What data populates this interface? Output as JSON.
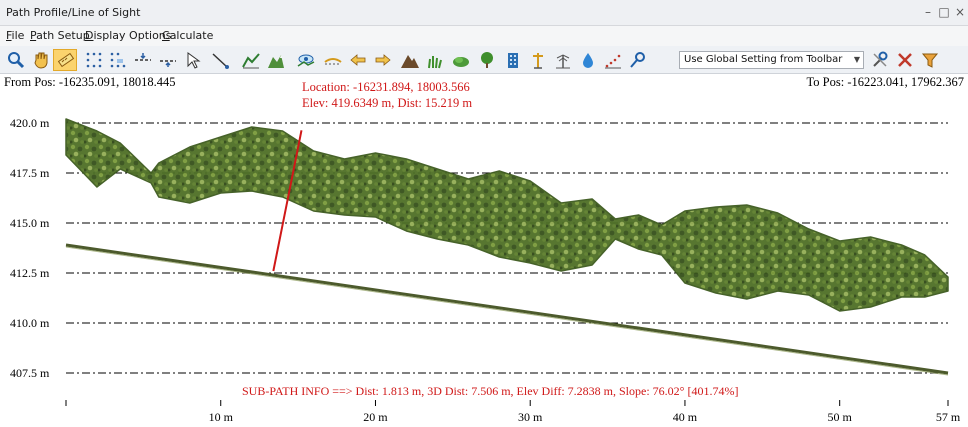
{
  "window": {
    "title": "Path Profile/Line of Sight",
    "minimize_glyph": "–",
    "maximize_glyph": "□",
    "close_glyph": "×"
  },
  "menu": [
    {
      "label": "File",
      "underline": "F",
      "rest": "ile"
    },
    {
      "label": "Path Setup",
      "underline": "P",
      "rest": "ath Setup"
    },
    {
      "label": "Display Options",
      "underline": "D",
      "rest": "isplay Options"
    },
    {
      "label": "Calculate",
      "underline": "C",
      "rest": "alculate"
    }
  ],
  "toolbar": {
    "icons": [
      "zoom-icon",
      "pan-hand-icon",
      "measure-tool-icon",
      "grid-dots-icon",
      "grid-dots-alt-icon",
      "horizontal-line-icon",
      "horizontal-line-alt-icon",
      "pointer-icon",
      "line-icon",
      "terrain-chart-icon",
      "terrain-fill-icon",
      "eye-view-icon",
      "flat-line-icon",
      "arrow-left-icon",
      "arrow-right-icon",
      "mountain-icon",
      "grass-icon",
      "bush-icon",
      "tree-icon",
      "building-icon",
      "tower-icon",
      "antenna-icon",
      "water-drop-icon",
      "dots-chart-icon",
      "pin-icon",
      "settings-tools-icon",
      "clear-icon",
      "filter-icon"
    ],
    "dropdown_value": "Use Global Setting from Toolbar"
  },
  "positions": {
    "from_label": "From Pos: -16235.091, 18018.445",
    "to_label": "To Pos: -16223.041, 17962.367"
  },
  "cursor_info": {
    "location": "Location: -16231.894, 18003.566",
    "elev": "Elev: 419.6349 m, Dist: 15.219 m"
  },
  "subpath_info": "SUB-PATH INFO ==> Dist: 1.813 m, 3D Dist: 7.506 m, Elev Diff: 7.2838 m, Slope: 76.02° [401.74%]",
  "chart_data": {
    "type": "scatter",
    "y_ticks": [
      "420.0 m",
      "417.5 m",
      "415.0 m",
      "412.5 m",
      "410.0 m",
      "407.5 m"
    ],
    "y_values": [
      420.0,
      417.5,
      415.0,
      412.5,
      410.0,
      407.5
    ],
    "x_ticks": [
      "10 m",
      "20 m",
      "30 m",
      "40 m",
      "50 m",
      "57 m"
    ],
    "x_values": [
      10,
      20,
      30,
      40,
      50,
      57
    ],
    "xlim": [
      0,
      57
    ],
    "ylim": [
      406.75,
      420.9
    ],
    "ground_line": {
      "start": [
        0,
        413.9
      ],
      "end": [
        57,
        407.5
      ]
    },
    "canopy_profile": [
      {
        "x": 0,
        "top": 420.2,
        "bottom": 418.4
      },
      {
        "x": 2,
        "top": 419.6,
        "bottom": 416.8
      },
      {
        "x": 3.5,
        "top": 419.0,
        "bottom": 417.7
      },
      {
        "x": 5.5,
        "top": 417.5,
        "bottom": 417.0
      },
      {
        "x": 6,
        "top": 418.0,
        "bottom": 416.3
      },
      {
        "x": 8,
        "top": 418.8,
        "bottom": 416.0
      },
      {
        "x": 10,
        "top": 419.3,
        "bottom": 416.5
      },
      {
        "x": 12,
        "top": 419.8,
        "bottom": 416.6
      },
      {
        "x": 14,
        "top": 419.6,
        "bottom": 416.3
      },
      {
        "x": 16,
        "top": 418.6,
        "bottom": 415.6
      },
      {
        "x": 18,
        "top": 418.2,
        "bottom": 415.4
      },
      {
        "x": 20,
        "top": 418.5,
        "bottom": 415.3
      },
      {
        "x": 22,
        "top": 418.2,
        "bottom": 414.6
      },
      {
        "x": 24,
        "top": 417.7,
        "bottom": 414.2
      },
      {
        "x": 26,
        "top": 417.2,
        "bottom": 413.9
      },
      {
        "x": 28,
        "top": 417.6,
        "bottom": 413.3
      },
      {
        "x": 30,
        "top": 417.1,
        "bottom": 413.0
      },
      {
        "x": 32,
        "top": 416.0,
        "bottom": 412.6
      },
      {
        "x": 34,
        "top": 416.2,
        "bottom": 412.9
      },
      {
        "x": 35.5,
        "top": 415.2,
        "bottom": 414.2
      },
      {
        "x": 37,
        "top": 415.4,
        "bottom": 413.7
      },
      {
        "x": 38.5,
        "top": 414.9,
        "bottom": 413.4
      },
      {
        "x": 40,
        "top": 415.6,
        "bottom": 412.0
      },
      {
        "x": 42,
        "top": 415.8,
        "bottom": 411.5
      },
      {
        "x": 44,
        "top": 415.9,
        "bottom": 411.2
      },
      {
        "x": 46,
        "top": 415.5,
        "bottom": 411.6
      },
      {
        "x": 48,
        "top": 414.7,
        "bottom": 411.4
      },
      {
        "x": 50,
        "top": 414.1,
        "bottom": 410.6
      },
      {
        "x": 52,
        "top": 414.3,
        "bottom": 410.8
      },
      {
        "x": 54,
        "top": 413.9,
        "bottom": 411.3
      },
      {
        "x": 55.5,
        "top": 413.4,
        "bottom": 411.3
      },
      {
        "x": 57,
        "top": 412.3,
        "bottom": 411.6
      }
    ],
    "sight_line": {
      "start": [
        13.4,
        412.6
      ],
      "end": [
        15.219,
        419.6349
      ]
    },
    "colors": {
      "canopy_dark": "#3d5a1e",
      "canopy_mid": "#6b8e2f",
      "canopy_light": "#a7bd6a",
      "ground": "#4c5a2c",
      "sight_line": "#d01818",
      "grid": "#000000"
    }
  }
}
